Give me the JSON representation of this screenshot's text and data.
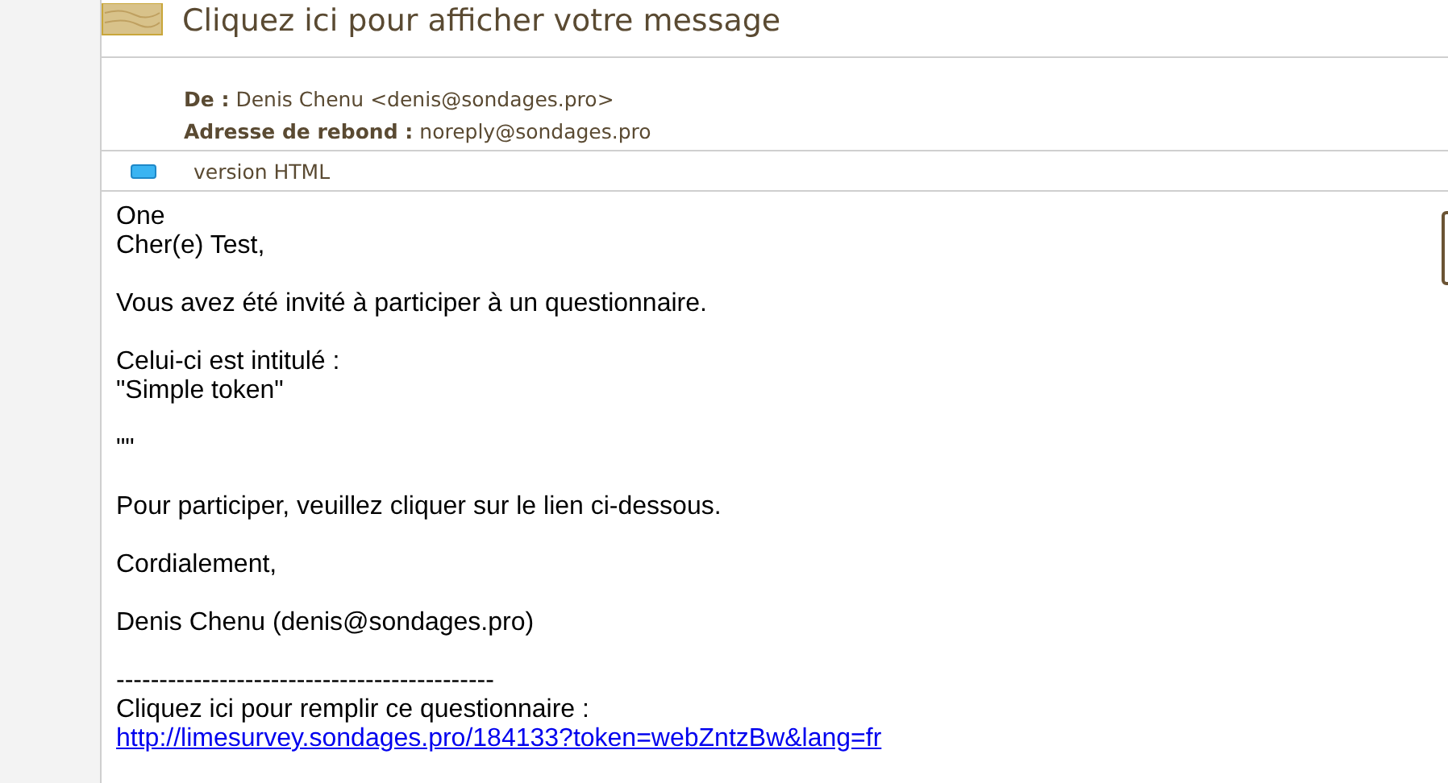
{
  "message": {
    "title": "Cliquez ici pour afficher votre message",
    "headers": [
      {
        "label": "De :",
        "value": "Denis Chenu <denis@sondages.pro>"
      },
      {
        "label": "Adresse de rebond :",
        "value": "noreply@sondages.pro"
      }
    ],
    "version": "version HTML"
  },
  "body": [
    {
      "kind": "text",
      "lines": [
        "One",
        "Cher(e) Test,"
      ]
    },
    {
      "kind": "text",
      "lines": [
        "Vous avez été invité à participer à un questionnaire."
      ]
    },
    {
      "kind": "text",
      "lines": [
        "Celui-ci est intitulé :",
        "\"Simple token\""
      ]
    },
    {
      "kind": "text",
      "lines": [
        "\"\""
      ]
    },
    {
      "kind": "text",
      "lines": [
        "Pour participer, veuillez cliquer sur le lien ci-dessous."
      ]
    },
    {
      "kind": "text",
      "lines": [
        "Cordialement,"
      ]
    },
    {
      "kind": "text",
      "lines": [
        "Denis Chenu (denis@sondages.pro)"
      ]
    },
    {
      "kind": "text",
      "lines": [
        "--------------------------------------------",
        "Cliquez ici pour remplir ce questionnaire :"
      ],
      "link": "http://limesurvey.sondages.pro/184133?token=webZntzBw&lang=fr"
    }
  ]
}
